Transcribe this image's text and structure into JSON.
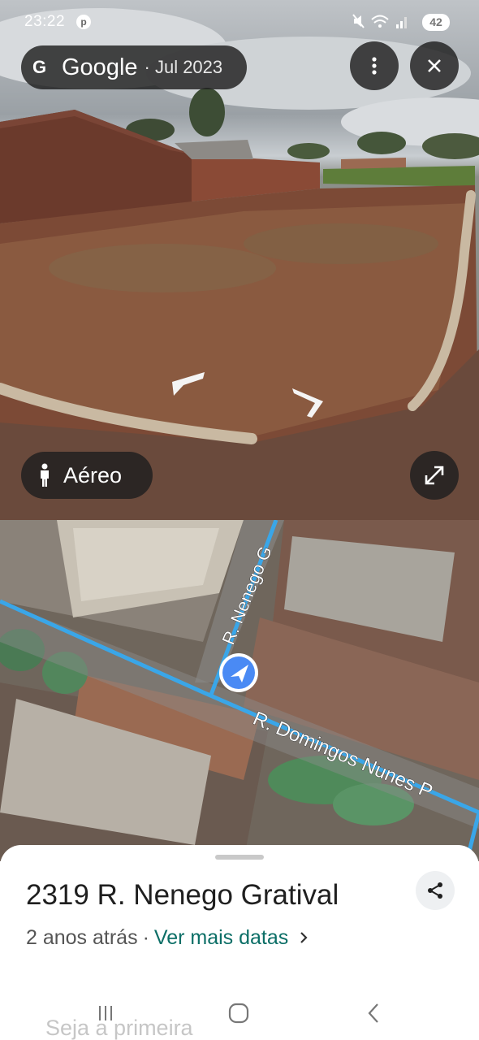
{
  "status_bar": {
    "time": "23:22",
    "notification_icon": "pinterest-icon",
    "system_icons": [
      "mute-icon",
      "wifi-icon",
      "signal-icon"
    ],
    "battery": "42"
  },
  "street_view": {
    "brand_icon": "google-g-icon",
    "brand": "Google",
    "capture_date": "· Jul 2023",
    "menu_icon": "more-vert-icon",
    "close_icon": "close-icon",
    "nav_arrows": [
      "arrow-left-icon",
      "arrow-right-icon"
    ],
    "view_mode_icon": "person-icon",
    "view_mode_label": "Aéreo",
    "expand_icon": "fullscreen-icon"
  },
  "map": {
    "street_labels": [
      "R. Nenego G",
      "R. Domingos Nunes P"
    ],
    "location_icon": "navigation-arrow-icon",
    "route_color": "#3aa6e8"
  },
  "place_sheet": {
    "address": "2319 R. Nenego Gratival",
    "age": "2 anos atrás",
    "separator": "·",
    "more_dates_link": "Ver mais datas",
    "share_icon": "share-icon",
    "below_fold_text": "Seja a primeira",
    "accent_color": "#0b6e66"
  },
  "nav_bar": {
    "buttons": [
      "recents-icon",
      "home-icon",
      "back-icon"
    ]
  }
}
